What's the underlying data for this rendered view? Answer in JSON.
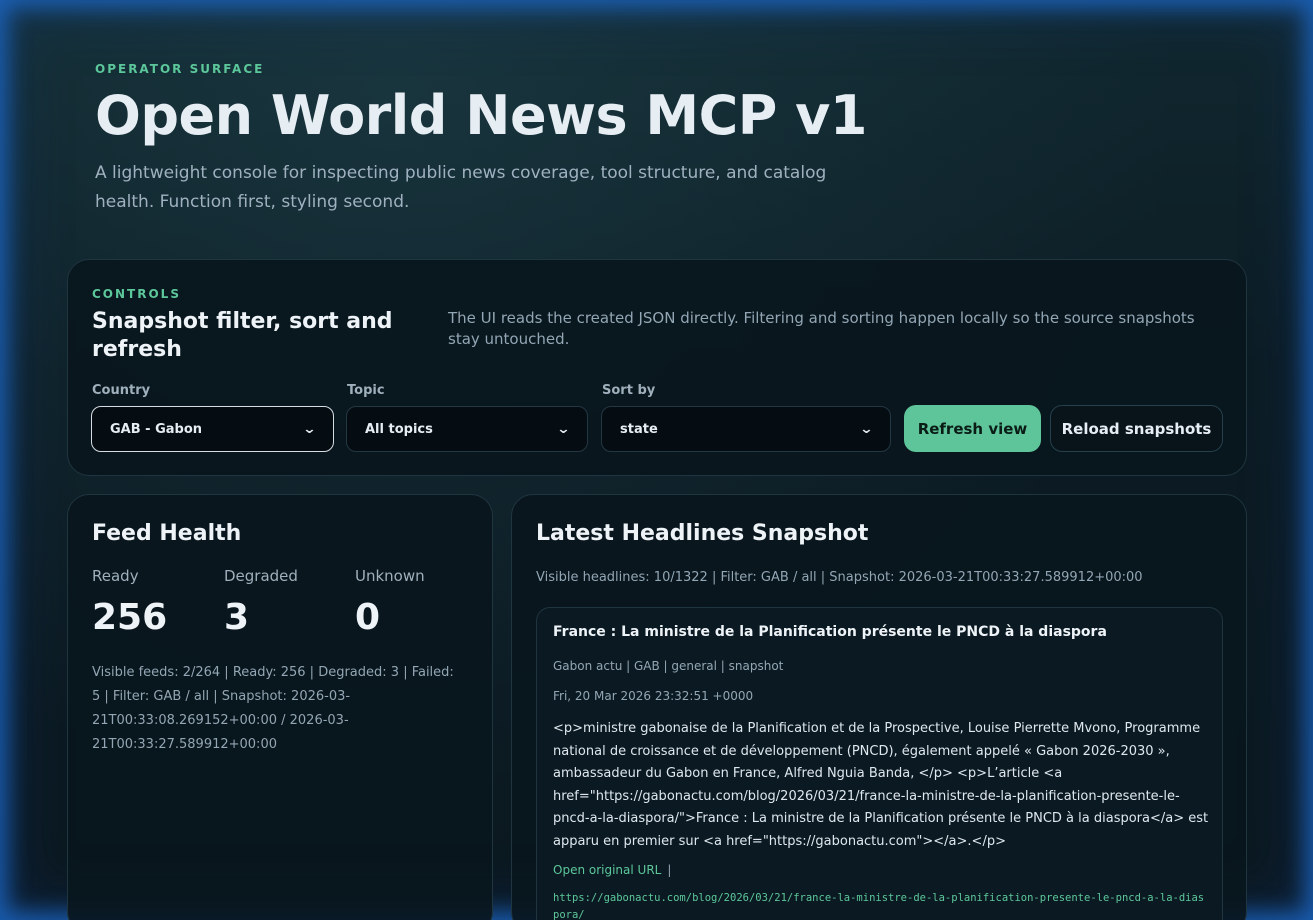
{
  "hero": {
    "eyebrow": "OPERATOR SURFACE",
    "title": "Open World News MCP v1",
    "subtitle": "A lightweight console for inspecting public news coverage, tool structure, and catalog health. Function first, styling second."
  },
  "controls": {
    "eyebrow": "CONTROLS",
    "title": "Snapshot filter, sort and refresh",
    "note": "The UI reads the created JSON directly. Filtering and sorting happen locally so the source snapshots stay untouched.",
    "country": {
      "label": "Country",
      "value": "GAB - Gabon"
    },
    "topic": {
      "label": "Topic",
      "value": "All topics"
    },
    "sort": {
      "label": "Sort by",
      "value": "state"
    },
    "refresh_label": "Refresh view",
    "reload_label": "Reload snapshots"
  },
  "health": {
    "title": "Feed Health",
    "stats": [
      {
        "label": "Ready",
        "value": "256"
      },
      {
        "label": "Degraded",
        "value": "3"
      },
      {
        "label": "Unknown",
        "value": "0"
      }
    ],
    "meta": "Visible feeds: 2/264 | Ready: 256 | Degraded: 3 | Failed: 5 | Filter: GAB / all | Snapshot: 2026-03-21T00:33:08.269152+00:00 / 2026-03-21T00:33:27.589912+00:00"
  },
  "headlines": {
    "title": "Latest Headlines Snapshot",
    "meta": "Visible headlines: 10/1322 | Filter: GAB / all | Snapshot: 2026-03-21T00:33:27.589912+00:00",
    "articles": [
      {
        "title": "France : La ministre de la Planification présente le PNCD à la diaspora",
        "source": "Gabon actu | GAB | general | snapshot",
        "date": "Fri, 20 Mar 2026 23:32:51 +0000",
        "body": "<p>ministre gabonaise de la Planification et de la Prospective, Louise Pierrette Mvono, Programme national de croissance et de développement (PNCD), également appelé « Gabon 2026-2030 », ambassadeur du Gabon en France, Alfred Nguia Banda, </p> <p>L’article <a href=\"https://gabonactu.com/blog/2026/03/21/france-la-ministre-de-la-planification-presente-le-pncd-a-la-diaspora/\">France : La ministre de la Planification présente le PNCD à la diaspora</a> est apparu en premier sur <a href=\"https://gabonactu.com\"></a>.</p>",
        "link_label": "Open original URL",
        "link_sep": "|",
        "url": "https://gabonactu.com/blog/2026/03/21/france-la-ministre-de-la-planification-presente-le-pncd-a-la-diaspora/"
      }
    ]
  }
}
